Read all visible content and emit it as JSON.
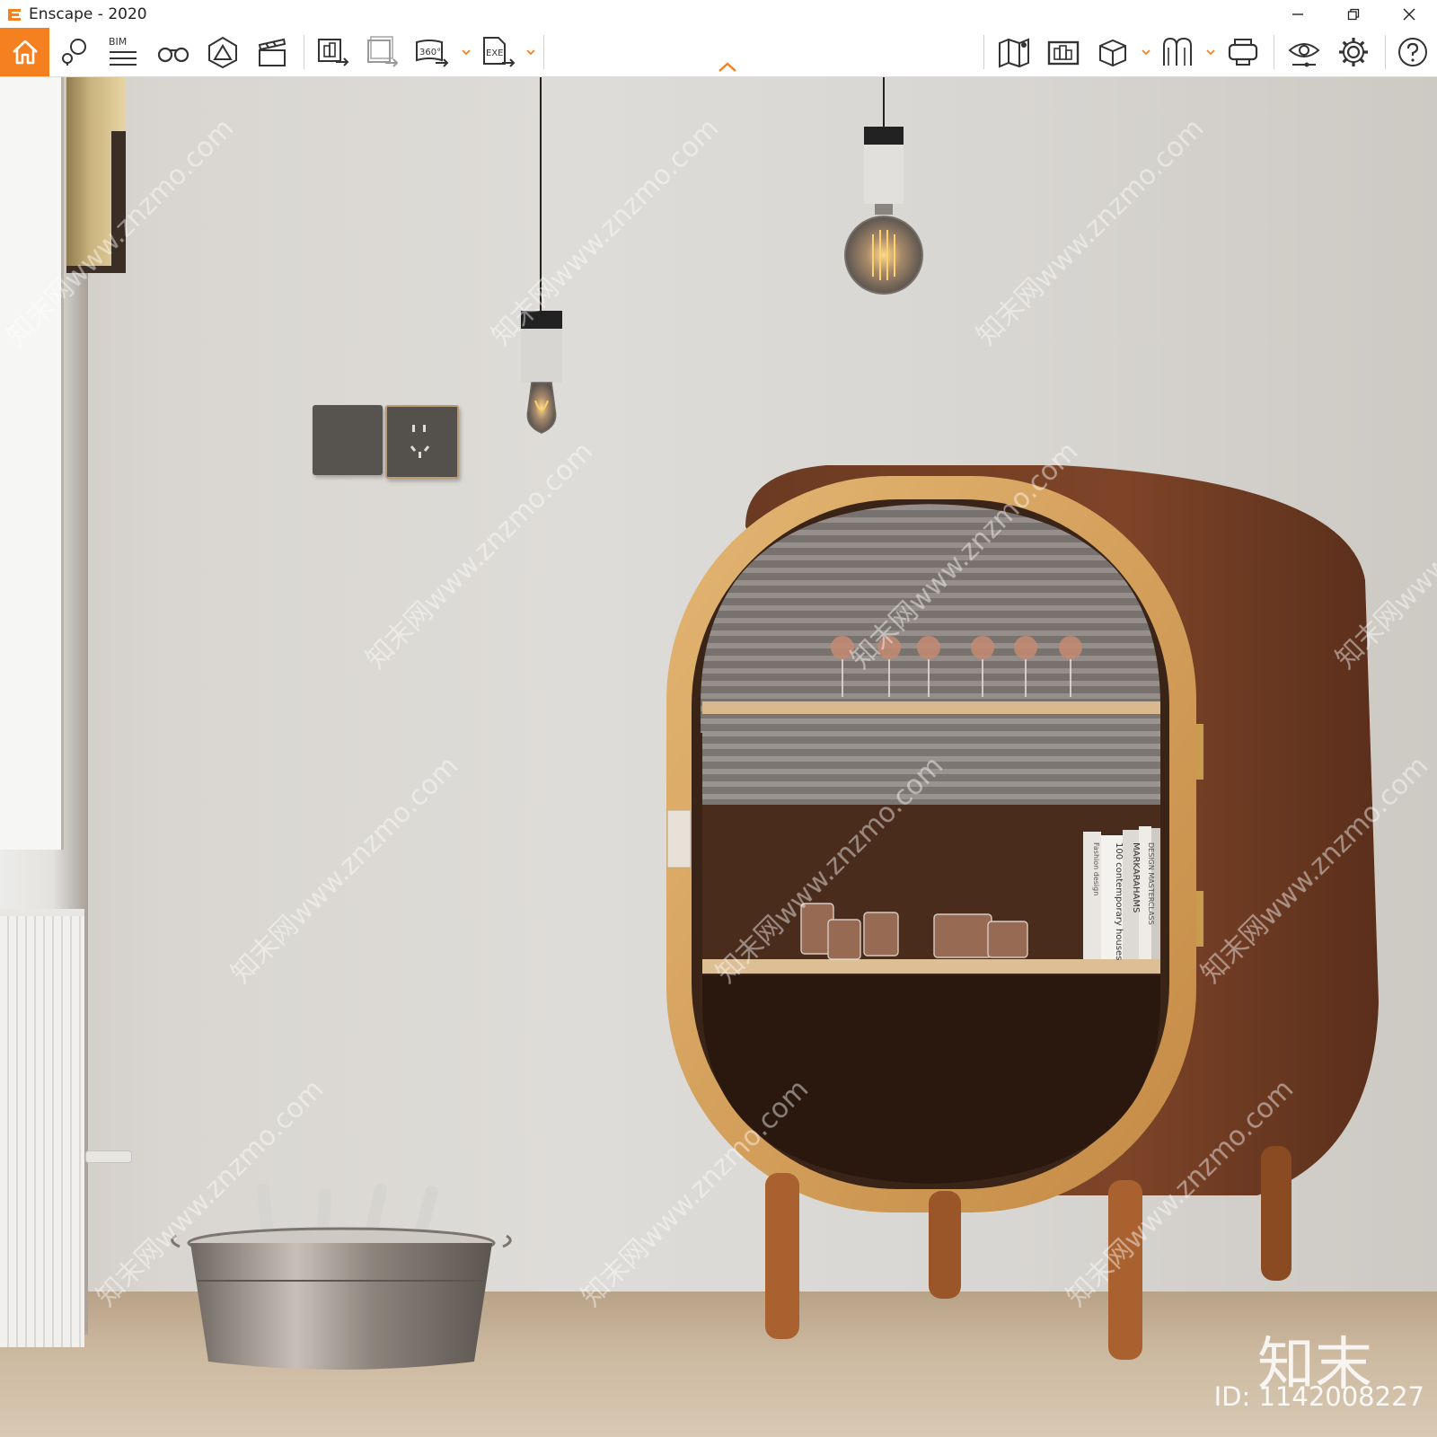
{
  "window": {
    "title": "Enscape - 2020",
    "controls": [
      "minimize",
      "restore",
      "close"
    ]
  },
  "toolbar": {
    "accent_color": "#f4801f",
    "left_group": [
      {
        "icon": "home-icon",
        "active": true
      },
      {
        "icon": "view-management-icon"
      },
      {
        "icon": "bim-icon",
        "label": "BIM"
      },
      {
        "icon": "binoculars-icon"
      },
      {
        "icon": "atmosphere-icon"
      },
      {
        "icon": "video-editor-icon"
      }
    ],
    "export_group": [
      {
        "icon": "screenshot-export-icon"
      },
      {
        "icon": "batch-render-icon"
      },
      {
        "icon": "panorama-export-icon",
        "label": "360°",
        "has_dropdown": true
      },
      {
        "icon": "exe-export-icon",
        "label": "EXE",
        "has_dropdown": true
      }
    ],
    "right_group": [
      {
        "icon": "map-icon"
      },
      {
        "icon": "upload-models-icon"
      },
      {
        "icon": "asset-library-icon",
        "has_dropdown": true
      },
      {
        "icon": "material-editor-icon",
        "has_dropdown": true
      },
      {
        "icon": "vr-headset-icon"
      },
      {
        "icon": "visual-settings-icon"
      },
      {
        "icon": "general-settings-icon"
      },
      {
        "icon": "help-icon"
      }
    ]
  },
  "viewport": {
    "book_spines": [
      "100 contemporary houses",
      "MARKARAHAMS",
      "DESIGN MASTERCLASS",
      "Fashion design"
    ],
    "watermark": {
      "brand": "知末",
      "id": "ID: 1142008227",
      "repeat": "知末网www.znzmo.com"
    }
  }
}
